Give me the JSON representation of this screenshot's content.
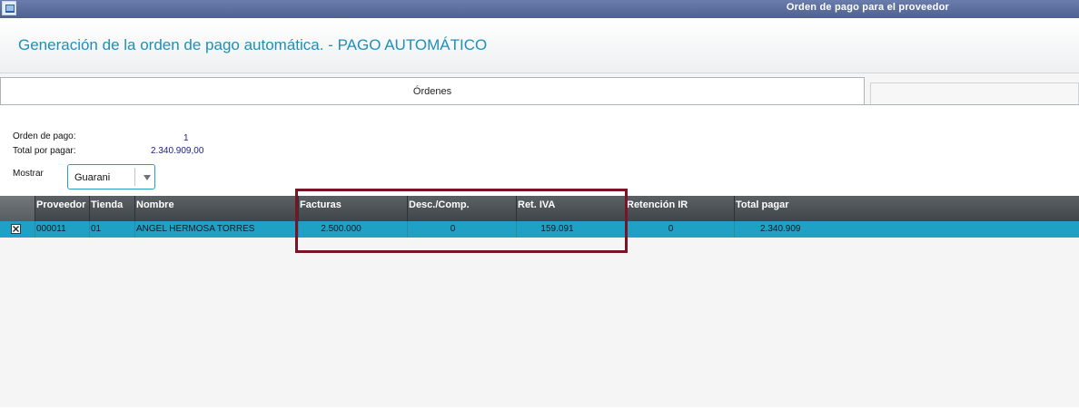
{
  "window": {
    "title": "Orden de pago para el proveedor",
    "icon": "window-icon"
  },
  "header": {
    "title": "Generación de la orden de pago automática. - PAGO AUTOMÁTICO"
  },
  "tabs": [
    {
      "label": "Órdenes",
      "active": true
    },
    {
      "label": "",
      "active": false
    }
  ],
  "summary": {
    "orden_label": "Orden de pago:",
    "orden_value": "1",
    "total_label": "Total por pagar:",
    "total_value": "2.340.909,00",
    "mostrar_label": "Mostrar",
    "mostrar_value": "Guarani"
  },
  "grid": {
    "columns": [
      "Proveedor",
      "Tienda",
      "Nombre",
      "Facturas",
      "Desc./Comp.",
      "Ret. IVA",
      "Retención IR",
      "Total pagar"
    ],
    "rows": [
      {
        "selected": true,
        "cells": [
          "000011",
          "01",
          "ANGEL HERMOSA TORRES",
          "2.500.000",
          "0",
          "159.091",
          "0",
          "2.340.909"
        ]
      }
    ]
  },
  "colors": {
    "titlebar": "#5d6f9f",
    "heading": "#1f8fba",
    "grid_header": "#4a4f54",
    "row_selected": "#1ea1c4",
    "highlight_box": "#7a1424"
  }
}
